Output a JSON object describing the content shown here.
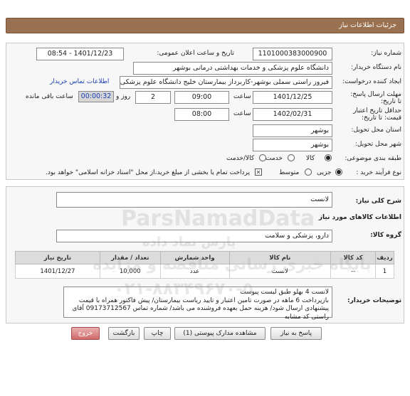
{
  "header": {
    "title": "جزئیات اطلاعات نیاز"
  },
  "need_number": {
    "label": "شماره نیاز:",
    "value": "1101000383000900"
  },
  "announce": {
    "label": "تاریخ و ساعت اعلان عمومی:",
    "value": "1401/12/23 - 08:54"
  },
  "buyer_org": {
    "label": "نام دستگاه خریدار:",
    "value": "دانشگاه علوم پزشکی و خدمات بهداشتی درمانی بوشهر"
  },
  "requester": {
    "label": "ایجاد کننده درخواست:",
    "value": "فیروز راستی سملی بوشهر-کاربرداز بیمارستان خلیج دانشگاه علوم پزشکی و خدمات",
    "contact_link": "اطلاعات تماس خریدار"
  },
  "deadline": {
    "label": "مهلت ارسال پاسخ: تا تاریخ:",
    "date": "1401/12/25",
    "time_label": "ساعت",
    "time": "09:00",
    "days": "2",
    "days_label": "روز و",
    "remaining": "00:00:32",
    "remaining_label": "ساعت باقی مانده"
  },
  "validity": {
    "label": "حداقل تاریخ اعتبار قیمت: تا تاریخ:",
    "date": "1402/02/31",
    "time_label": "ساعت",
    "time": "08:00"
  },
  "province": {
    "label": "استان محل تحویل:",
    "value": "بوشهر"
  },
  "city": {
    "label": "شهر محل تحویل:",
    "value": "بوشهر"
  },
  "category": {
    "label": "طبقه بندی موضوعی:",
    "options": [
      "کالا",
      "خدمت",
      "کالا/خدمت"
    ],
    "selected": "کالا"
  },
  "process": {
    "label": "نوع فرآیند خرید :",
    "options": [
      "جزیی",
      "متوسط"
    ],
    "selected": "جزیی",
    "note": "پرداخت تمام یا بخشی از مبلغ خرید،از محل \"اسناد خزانه اسلامی\" خواهد بود."
  },
  "summary": {
    "label": "شرح کلی نیاز:",
    "value": "لانست"
  },
  "goods_info_title": "اطلاعات کالاهای مورد نیاز",
  "goods_group": {
    "label": "گروه کالا:",
    "value": "دارو، پزشکی و سلامت"
  },
  "table": {
    "headers": [
      "ردیف",
      "کد کالا",
      "نام کالا",
      "واحد شمارش",
      "تعداد / مقدار",
      "تاریخ نیاز"
    ],
    "rows": [
      {
        "row": "1",
        "code": "--",
        "name": "لانست",
        "unit": "عدد",
        "qty": "10,000",
        "date": "1401/12/27"
      }
    ]
  },
  "buyer_notes": {
    "label": "توضیحات خریدار:",
    "text": "لانست 4 بهلو طبق لیست پیوست\nبازپرداخت 6 ماهه در صورت تامین اعتبار و تایید ریاست بیمارستان/ پیش فاکتور همراه با قیمت پیشنهادی ارسال شود/ هزینه حمل بعهده فروشنده می باشد/ شماره تماس 09173712567 آقای راستی کد مشابه"
  },
  "buttons": {
    "reply": "پاسخ به نیاز",
    "attachments": "مشاهده مدارک پیوستی (1)",
    "print": "چاپ",
    "back": "بازگشت",
    "exit": "خروج"
  },
  "watermark": {
    "brand": "ParsNamadData",
    "brand_fa": "پارس نماد داده",
    "line1": "پایگاه خبری رسانی مناقصه و مزایده",
    "phone": "۰۲۱-۸۸۳۴۹۶۷۰-۵"
  },
  "colors": {
    "header": "#9a7150",
    "link": "#1a3fb8",
    "exit_button": "#d06a6a"
  }
}
